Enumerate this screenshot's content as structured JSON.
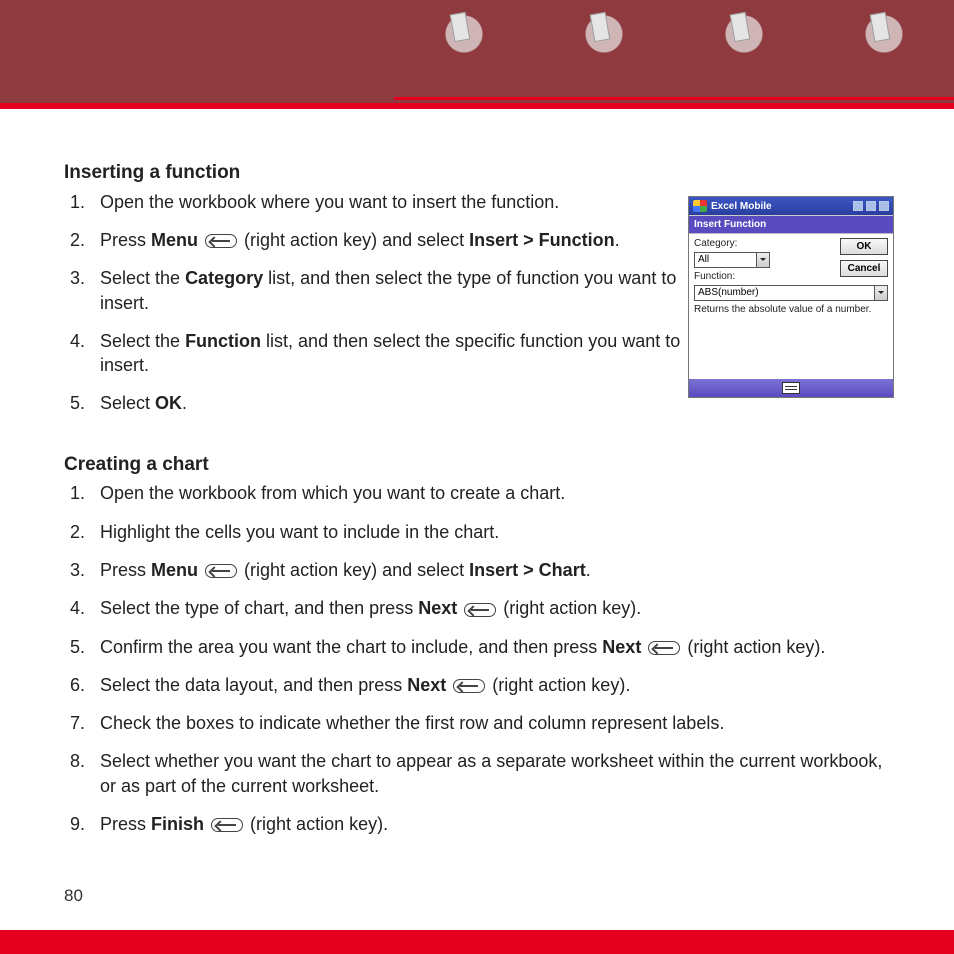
{
  "page_number": "80",
  "section1": {
    "heading": "Inserting a function",
    "step1": "Open the workbook where you want to insert the function.",
    "step2_a": "Press ",
    "step2_menu": "Menu",
    "step2_b": " (right action key) and select ",
    "step2_path": "Insert > Function",
    "step2_c": ".",
    "step3_a": "Select the ",
    "step3_b": "Category",
    "step3_c": " list, and then select the type of function you want to insert.",
    "step4_a": "Select the ",
    "step4_b": "Function",
    "step4_c": " list, and then select the specific function you want to insert.",
    "step5_a": "Select ",
    "step5_b": "OK",
    "step5_c": "."
  },
  "section2": {
    "heading": "Creating a chart",
    "step1": "Open the workbook from which you want to create a chart.",
    "step2": "Highlight the cells you want to include in the chart.",
    "step3_a": "Press ",
    "step3_menu": "Menu",
    "step3_b": " (right action key) and select ",
    "step3_path": "Insert > Chart",
    "step3_c": ".",
    "step4_a": "Select the type of chart, and then press ",
    "step4_b": "Next",
    "step4_c": " (right action key).",
    "step5_a": "Confirm the area you want the chart to include, and then press ",
    "step5_b": "Next",
    "step5_c": " (right action key).",
    "step6_a": "Select the data layout, and then press ",
    "step6_b": "Next",
    "step6_c": " (right action key).",
    "step7": "Check the boxes to indicate whether the first row and column represent labels.",
    "step8": "Select whether you want the chart to appear as a separate worksheet within the current workbook, or as part of the current worksheet.",
    "step9_a": "Press ",
    "step9_b": "Finish",
    "step9_c": " (right action key)."
  },
  "screenshot": {
    "app_title": "Excel Mobile",
    "dialog_title": "Insert Function",
    "category_label": "Category:",
    "category_value": "All",
    "function_label": "Function:",
    "function_value": "ABS(number)",
    "description": "Returns the absolute value of a number.",
    "ok_label": "OK",
    "cancel_label": "Cancel"
  }
}
